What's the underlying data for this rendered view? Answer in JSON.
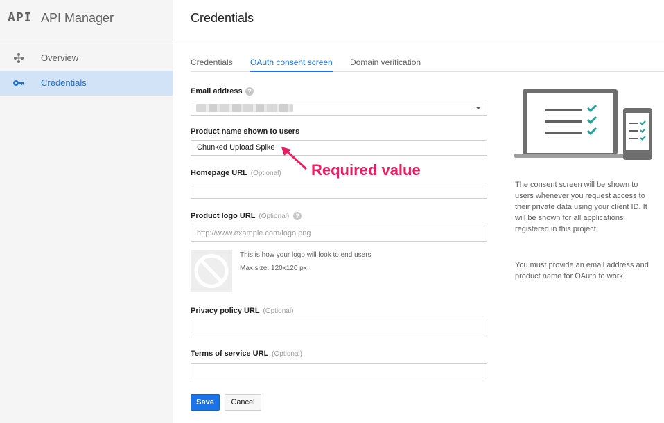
{
  "sidebar": {
    "brand_logo": "API",
    "brand_title": "API Manager",
    "items": [
      {
        "label": "Overview",
        "icon": "overview-icon"
      },
      {
        "label": "Credentials",
        "icon": "key-icon",
        "active": true
      }
    ]
  },
  "header": {
    "title": "Credentials"
  },
  "tabs": [
    {
      "label": "Credentials"
    },
    {
      "label": "OAuth consent screen",
      "active": true
    },
    {
      "label": "Domain verification"
    }
  ],
  "form": {
    "email": {
      "label": "Email address"
    },
    "product_name": {
      "label": "Product name shown to users",
      "value": "Chunked Upload Spike"
    },
    "homepage": {
      "label": "Homepage URL",
      "optional": "(Optional)",
      "value": ""
    },
    "logo_url": {
      "label": "Product logo URL",
      "optional": "(Optional)",
      "placeholder": "http://www.example.com/logo.png"
    },
    "logo_hint": {
      "line1": "This is how your logo will look to end users",
      "line2": "Max size: 120x120 px"
    },
    "privacy": {
      "label": "Privacy policy URL",
      "optional": "(Optional)",
      "value": ""
    },
    "terms": {
      "label": "Terms of service URL",
      "optional": "(Optional)",
      "value": ""
    }
  },
  "buttons": {
    "save": "Save",
    "cancel": "Cancel"
  },
  "annotation": "Required value",
  "info": {
    "p1": "The consent screen will be shown to users whenever you request access to their private data using your client ID. It will be shown for all applications registered in this project.",
    "p2": "You must provide an email address and product name for OAuth to work."
  },
  "colors": {
    "accent": "#1a73e8",
    "annotation": "#e91e63",
    "check": "#1fa39a"
  }
}
